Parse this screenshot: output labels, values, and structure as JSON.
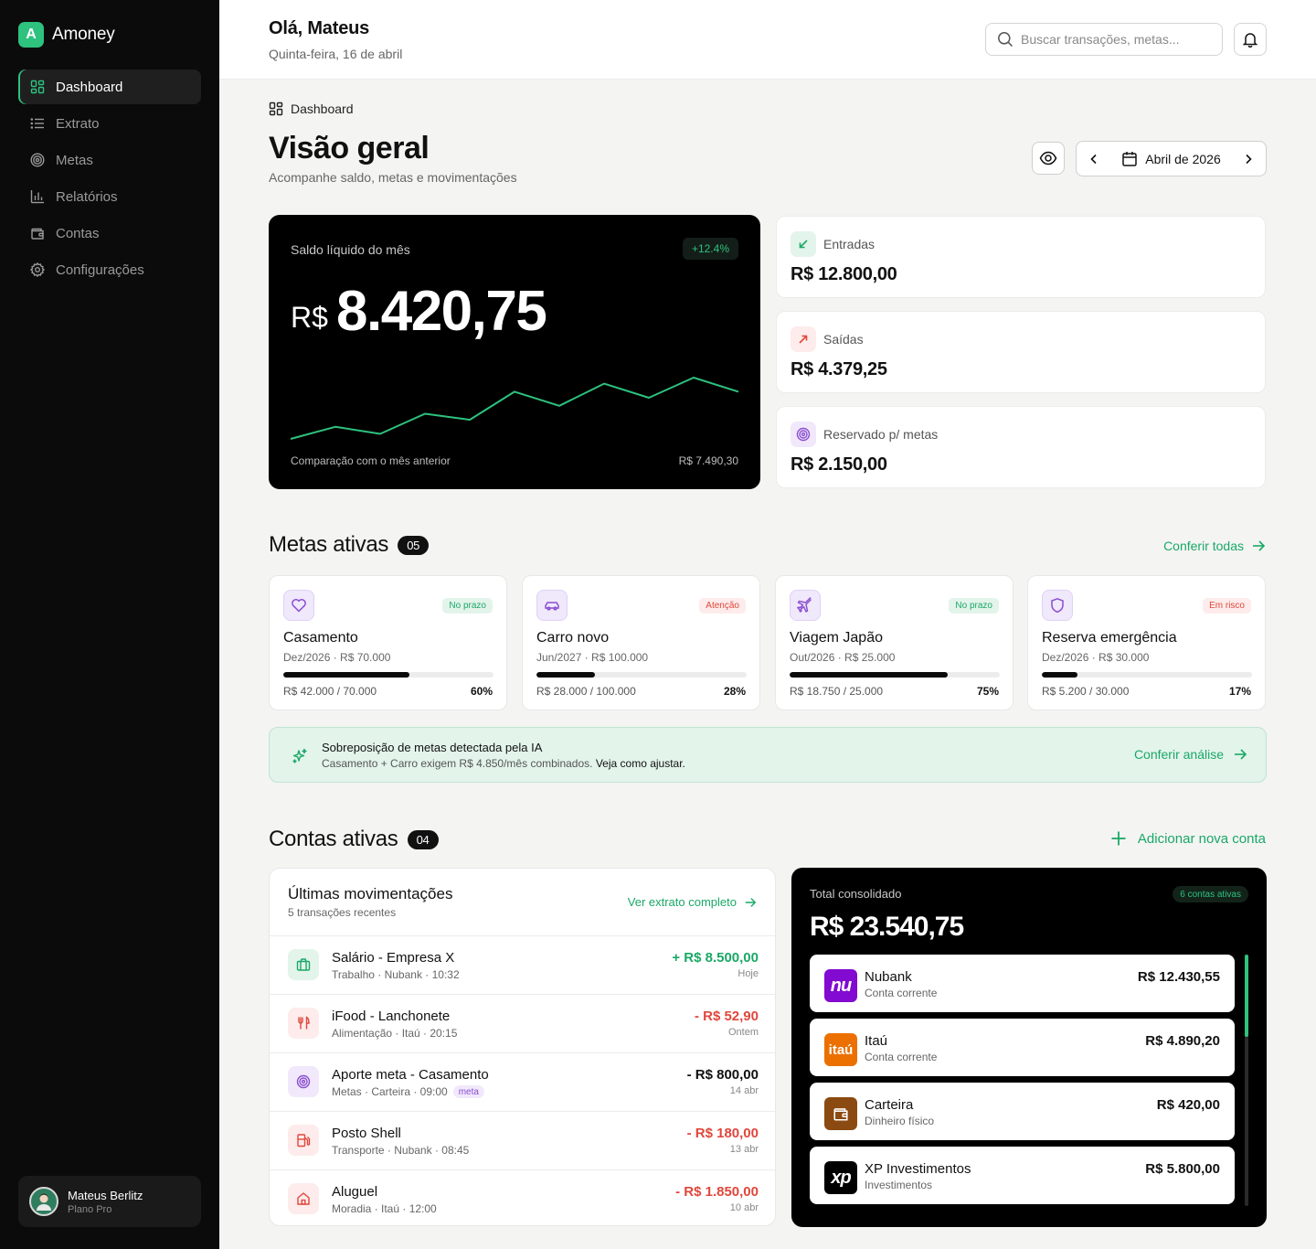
{
  "brand": {
    "initial": "A",
    "name": "Amoney",
    "accent": "#2ec27e"
  },
  "nav": [
    {
      "label": "Dashboard",
      "icon": "grid-icon",
      "active": true
    },
    {
      "label": "Extrato",
      "icon": "list-icon"
    },
    {
      "label": "Metas",
      "icon": "target-icon"
    },
    {
      "label": "Relatórios",
      "icon": "bar-chart-icon"
    },
    {
      "label": "Contas",
      "icon": "wallet-icon"
    },
    {
      "label": "Configurações",
      "icon": "gear-icon"
    }
  ],
  "user": {
    "name": "Mateus Berlitz",
    "plan": "Plano Pro"
  },
  "header": {
    "greeting": "Olá, Mateus",
    "date": "Quinta-feira, 16 de abril",
    "search_placeholder": "Buscar transações, metas..."
  },
  "page": {
    "breadcrumb": "Dashboard",
    "title": "Visão geral",
    "subtitle": "Acompanhe saldo, metas e movimentações",
    "month": "Abril de 2026"
  },
  "balance": {
    "label": "Saldo líquido do mês",
    "change": "+12.4%",
    "currency": "R$",
    "value": "8.420,75",
    "comparison_label": "Comparação com o mês anterior",
    "previous_value": "R$ 7.490,30",
    "trend": [
      3,
      15,
      8,
      28,
      22,
      50,
      36,
      58,
      44,
      64,
      50
    ],
    "line_color": "#2ec27e"
  },
  "stats": [
    {
      "label": "Entradas",
      "value": "R$ 12.800,00",
      "icon": "arrow-down-left-icon"
    },
    {
      "label": "Saídas",
      "value": "R$ 4.379,25",
      "icon": "arrow-up-right-icon"
    },
    {
      "label": "Reservado p/ metas",
      "value": "R$ 2.150,00",
      "icon": "target-icon"
    }
  ],
  "goals_section": {
    "title": "Metas ativas",
    "count": "05",
    "link": "Conferir todas"
  },
  "goals": [
    {
      "name": "Casamento",
      "meta": "Dez/2026 · R$ 70.000",
      "status": "No prazo",
      "progress_text": "R$ 42.000 / 70.000",
      "pct": "60%",
      "pct_value": 60,
      "icon": "heart-icon"
    },
    {
      "name": "Carro novo",
      "meta": "Jun/2027 · R$ 100.000",
      "status": "Atenção",
      "progress_text": "R$ 28.000 / 100.000",
      "pct": "28%",
      "pct_value": 28,
      "icon": "car-icon"
    },
    {
      "name": "Viagem Japão",
      "meta": "Out/2026 · R$ 25.000",
      "status": "No prazo",
      "progress_text": "R$ 18.750 / 25.000",
      "pct": "75%",
      "pct_value": 75,
      "icon": "plane-icon"
    },
    {
      "name": "Reserva emergência",
      "meta": "Dez/2026 · R$ 30.000",
      "status": "Em risco",
      "progress_text": "R$ 5.200 / 30.000",
      "pct": "17%",
      "pct_value": 17,
      "icon": "shield-icon"
    }
  ],
  "ai_banner": {
    "title": "Sobreposição de metas detectada pela IA",
    "description": "Casamento + Carro exigem R$ 4.850/mês combinados.",
    "description_cta": "Veja como ajustar.",
    "link": "Conferir análise"
  },
  "accounts_section": {
    "title": "Contas ativas",
    "count": "04",
    "link": "Adicionar nova conta"
  },
  "transactions": {
    "title": "Últimas movimentações",
    "subtitle": "5 transações recentes",
    "link": "Ver extrato completo",
    "items": [
      {
        "name": "Salário - Empresa X",
        "meta": "Trabalho · Nubank · 10:32",
        "amount": "+ R$ 8.500,00",
        "when": "Hoje",
        "type": "in",
        "icon": "briefcase-icon"
      },
      {
        "name": "iFood - Lanchonete",
        "meta": "Alimentação · Itaú · 20:15",
        "amount": "- R$ 52,90",
        "when": "Ontem",
        "type": "out",
        "icon": "utensils-icon"
      },
      {
        "name": "Aporte meta - Casamento",
        "meta": "Metas · Carteira · 09:00",
        "tag": "meta",
        "amount": "- R$ 800,00",
        "when": "14 abr",
        "type": "goal",
        "icon": "target-icon"
      },
      {
        "name": "Posto Shell",
        "meta": "Transporte · Nubank · 08:45",
        "amount": "- R$ 180,00",
        "when": "13 abr",
        "type": "out",
        "icon": "fuel-icon"
      },
      {
        "name": "Aluguel",
        "meta": "Moradia · Itaú · 12:00",
        "amount": "- R$ 1.850,00",
        "when": "10 abr",
        "type": "out",
        "icon": "home-icon"
      }
    ]
  },
  "consolidated": {
    "label": "Total consolidado",
    "badge": "6 contas ativas",
    "value": "R$ 23.540,75",
    "accounts": [
      {
        "name": "Nubank",
        "type": "Conta corrente",
        "value": "R$ 12.430,55",
        "logo_text": "nu",
        "color": "#820ad1"
      },
      {
        "name": "Itaú",
        "type": "Conta corrente",
        "value": "R$ 4.890,20",
        "logo_text": "itaú",
        "color": "#ec7000"
      },
      {
        "name": "Carteira",
        "type": "Dinheiro físico",
        "value": "R$ 420,00",
        "logo_text": "",
        "color": "#8b4a12"
      },
      {
        "name": "XP Investimentos",
        "type": "Investimentos",
        "value": "R$ 5.800,00",
        "logo_text": "xp",
        "color": "#000000"
      }
    ]
  }
}
